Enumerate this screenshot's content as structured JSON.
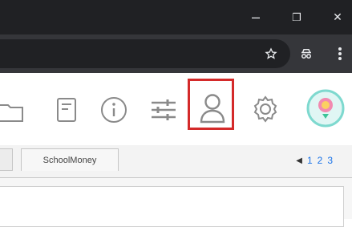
{
  "window_controls": {
    "minimize_symbol": "–",
    "restore_symbol": "❐",
    "close_symbol": "✕"
  },
  "toolbar": {
    "icons": [
      "folder-icon",
      "document-icon",
      "info-icon",
      "sliders-icon",
      "user-icon",
      "gear-icon",
      "avatar-icon"
    ],
    "highlighted_icon": "user-icon",
    "highlight_color": "#d42a2a"
  },
  "tabs": {
    "active_label": "SchoolMoney"
  },
  "pager": {
    "prev_symbol": "◀",
    "pages": [
      "1",
      "2",
      "3"
    ]
  },
  "colors": {
    "titlebar": "#202124",
    "addressbar": "#35363a",
    "icon_gray": "#8a8a8a",
    "link_blue": "#1a73e8"
  }
}
